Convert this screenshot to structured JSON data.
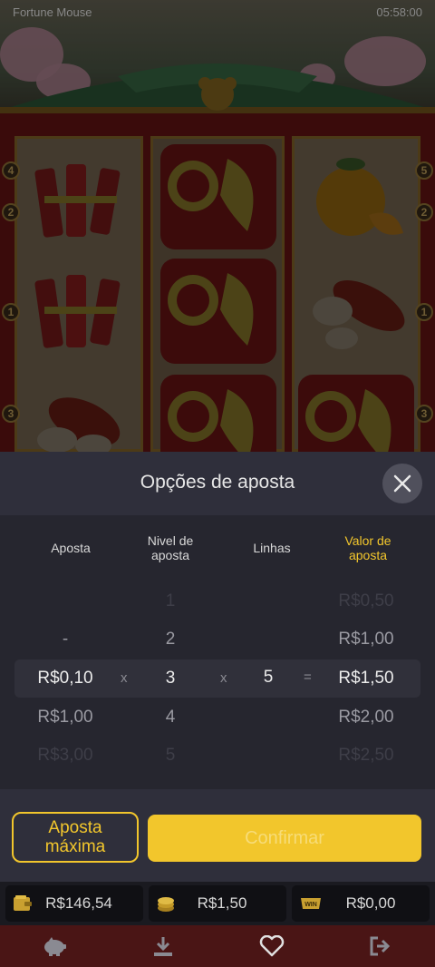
{
  "game": {
    "status_left": "Fortune Mouse",
    "status_right": "05:58:00",
    "line_badges_left": [
      "4",
      "2",
      "1",
      "3"
    ],
    "line_badges_right": [
      "5",
      "2",
      "1",
      "3"
    ]
  },
  "panel": {
    "title": "Opções de aposta",
    "columns": {
      "bet": "Aposta",
      "level": "Nivel de aposta",
      "lines": "Linhas",
      "value": "Valor de aposta"
    },
    "rows": [
      {
        "bet": "",
        "level": "1",
        "lines": "",
        "value": "R$0,50"
      },
      {
        "bet": "-",
        "level": "2",
        "lines": "",
        "value": "R$1,00"
      },
      {
        "bet": "R$0,10",
        "level": "3",
        "lines": "5",
        "value": "R$1,50",
        "op_x1": "x",
        "op_x2": "x",
        "op_eq": "="
      },
      {
        "bet": "R$1,00",
        "level": "4",
        "lines": "",
        "value": "R$2,00"
      },
      {
        "bet": "R$3,00",
        "level": "5",
        "lines": "",
        "value": "R$2,50"
      }
    ]
  },
  "buttons": {
    "max_bet": "Aposta máxima",
    "confirm": "Confirmar"
  },
  "balance": {
    "wallet": "R$146,54",
    "bet": "R$1,50",
    "win": "R$0,00",
    "win_badge": "WIN"
  },
  "colors": {
    "accent": "#f2c62c",
    "panel_bg": "#2f2f3b",
    "nav_bg": "#4a1515"
  }
}
